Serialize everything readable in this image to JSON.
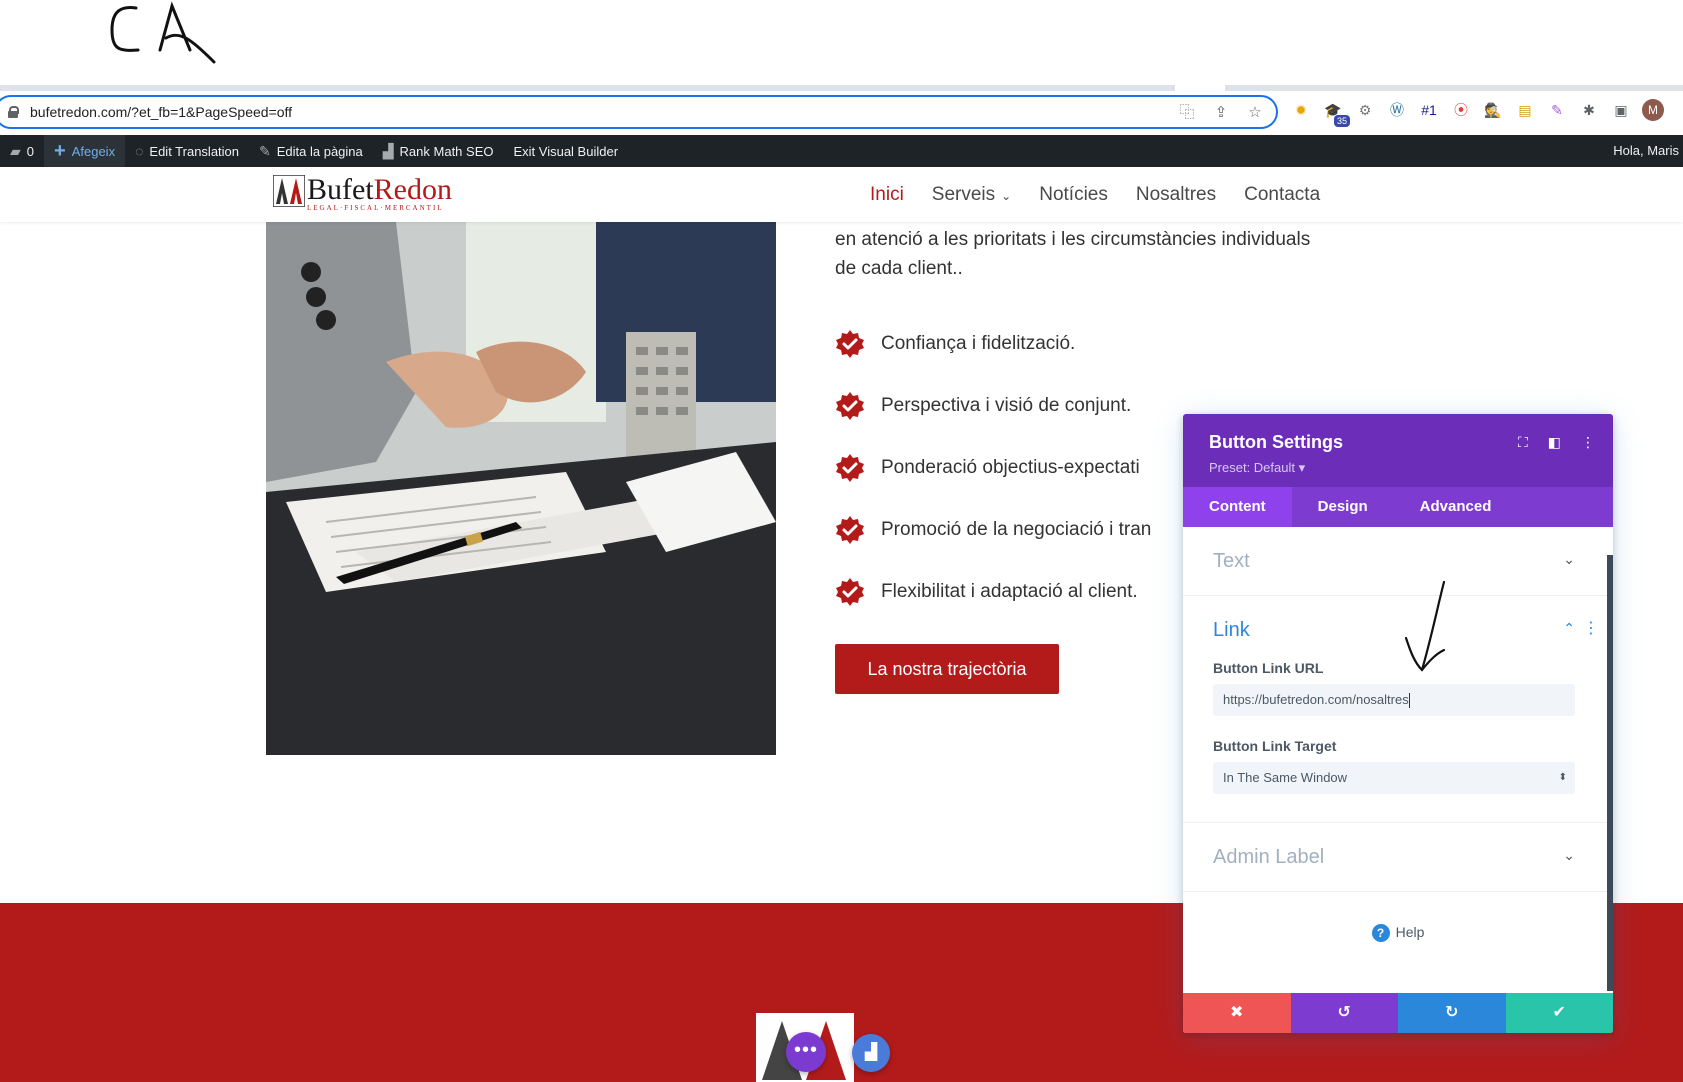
{
  "address_bar": {
    "url": "bufetredon.com/?et_fb=1&PageSpeed=off"
  },
  "extensions": [
    {
      "icon": "puzzle-colorful-icon",
      "glyph": "✹",
      "color": "#e8a400"
    },
    {
      "icon": "graduation-cap-icon",
      "glyph": "🎓",
      "color": "#3949ab",
      "badge": "35"
    },
    {
      "icon": "gear-badge-icon",
      "glyph": "⚙",
      "color": "#777"
    },
    {
      "icon": "wordpress-icon",
      "glyph": "Ⓦ",
      "color": "#21759b"
    },
    {
      "icon": "rank-one-icon",
      "glyph": "#1",
      "color": "#1a1a8c"
    },
    {
      "icon": "location-pin-icon",
      "glyph": "⦿",
      "color": "#e53935"
    },
    {
      "icon": "spy-icon",
      "glyph": "🕵",
      "color": "#333"
    },
    {
      "icon": "folder-icon",
      "glyph": "▤",
      "color": "#d4a017"
    },
    {
      "icon": "feather-icon",
      "glyph": "✎",
      "color": "#a55fd6"
    },
    {
      "icon": "extensions-puzzle-icon",
      "glyph": "✱",
      "color": "#5f6368"
    },
    {
      "icon": "sidepanel-icon",
      "glyph": "▣",
      "color": "#5f6368"
    }
  ],
  "profile_initial": "M",
  "wp_bar": {
    "comments_count": "0",
    "add_label": "Afegeix",
    "edit_translation_label": "Edit Translation",
    "edit_page_label": "Edita la pàgina",
    "rank_math_label": "Rank Math SEO",
    "exit_builder_label": "Exit Visual Builder",
    "greeting": "Hola, Maris"
  },
  "site": {
    "logo_brand_1": "Bufet",
    "logo_brand_2": "Redon",
    "logo_tagline": "LEGAL·FISCAL·MERCANTIL",
    "nav": [
      "Inici",
      "Serveis",
      "Notícies",
      "Nosaltres",
      "Contacta"
    ],
    "intro": "en atenció a les prioritats i les circumstàncies individuals de cada client..",
    "features": [
      "Confiança i fidelització.",
      "Perspectiva i visió de conjunt.",
      "Ponderació objectius-expectati",
      "Promoció de la negociació i tran",
      "Flexibilitat i adaptació al client."
    ],
    "cta_label": "La nostra trajectòria",
    "colors": {
      "brand_red": "#b31b1b",
      "divi_purple": "#6c2eb9",
      "divi_blue": "#2b87da"
    }
  },
  "modal": {
    "title": "Button Settings",
    "preset": "Preset: Default ▾",
    "tabs": [
      "Content",
      "Design",
      "Advanced"
    ],
    "sections": {
      "text": "Text",
      "link": "Link",
      "admin_label": "Admin Label"
    },
    "button_link_url_label": "Button Link URL",
    "button_link_url_value": "https://bufetredon.com/nosaltres",
    "button_link_target_label": "Button Link Target",
    "button_link_target_value": "In The Same Window",
    "help_label": "Help"
  },
  "annotation": {
    "handwritten_text": "CA"
  }
}
